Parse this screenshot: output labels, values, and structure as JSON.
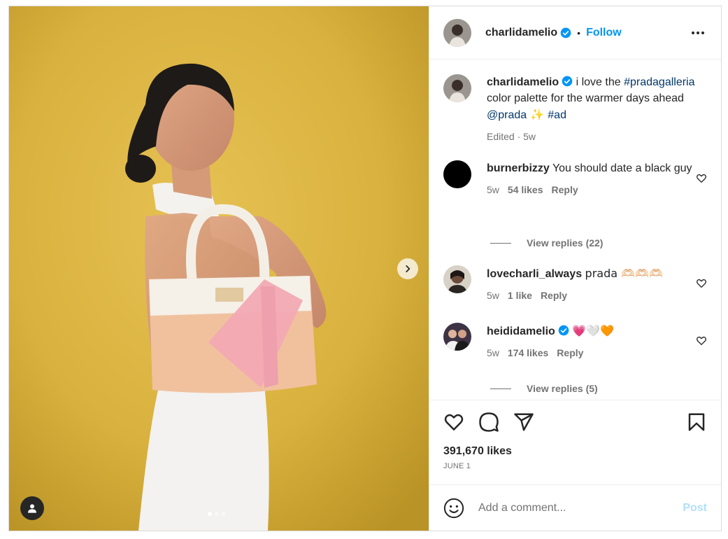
{
  "post": {
    "author": "charlidamelio",
    "verified": true,
    "follow_label": "Follow",
    "separator": "•",
    "more_label": "more options"
  },
  "caption": {
    "user": "charlidamelio",
    "text_1": " i love the ",
    "hashtag_1": "#pradagalleria",
    "text_2": " color palette for the warmer days ahead ",
    "mention": "@prada",
    "emoji": " ✨ ",
    "hashtag_2": "#ad",
    "meta": "Edited · 5w"
  },
  "comments": [
    {
      "user": "burnerbizzy",
      "text": "You should date a black guy",
      "time": "5w",
      "likes": "54 likes",
      "reply_label": "Reply",
      "view_replies": "View replies (22)"
    },
    {
      "user": "lovecharli_always",
      "text": "prada 🫶🏻🫶🏻🫶🏻",
      "time": "5w",
      "likes": "1 like",
      "reply_label": "Reply"
    },
    {
      "user": "heididamelio",
      "verified": true,
      "text": "💗🤍🧡",
      "time": "5w",
      "likes": "174 likes",
      "reply_label": "Reply",
      "view_replies": "View replies (5)"
    }
  ],
  "actions": {
    "likes_count": "391,670 likes",
    "date": "JUNE 1"
  },
  "add_comment": {
    "placeholder": "Add a comment...",
    "post_label": "Post"
  },
  "carousel": {
    "slides": 3,
    "active": 1
  },
  "colors": {
    "accent": "#0095f6",
    "link": "#00376b",
    "muted": "#737373",
    "verified": "#0095f6"
  }
}
